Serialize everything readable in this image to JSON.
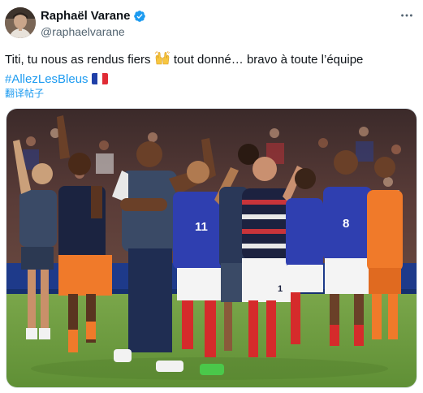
{
  "author": {
    "display_name": "Raphaël Varane",
    "handle": "@raphaelvarane",
    "verified": true,
    "verified_color": "#1d9bf0"
  },
  "tweet": {
    "text_line1": "Titi, tu nous as rendus fiers",
    "text_line1_cont": "tout donné… bravo à toute l’équipe",
    "hashtag": "#AllezLesBleus",
    "emoji_hands": "raised-hands-emoji",
    "emoji_flag": "france-flag-emoji",
    "translate_label": "翻译帖子"
  },
  "media": {
    "image": "photo-france-team-applauding",
    "jersey_numbers": [
      "11",
      "8",
      "1"
    ]
  },
  "icons": {
    "more": "more-icon",
    "verified": "verified-badge-icon"
  },
  "colors": {
    "text": "#0f1419",
    "secondary": "#536471",
    "link": "#1d9bf0"
  }
}
